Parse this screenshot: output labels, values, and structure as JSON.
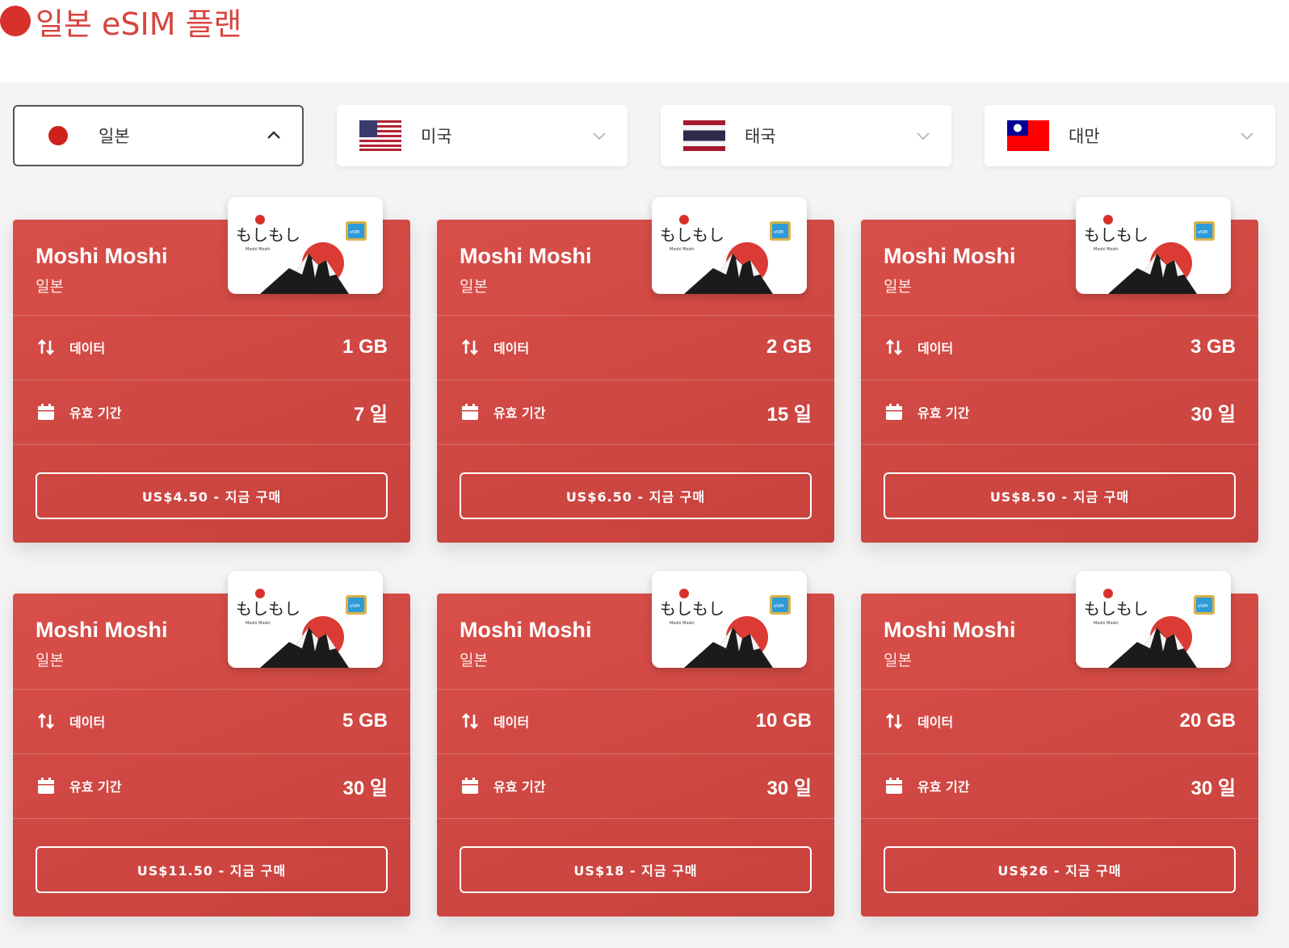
{
  "title": "일본 eSIM 플랜",
  "colors": {
    "accent": "#d8453f",
    "card": "#d04a45"
  },
  "countries": [
    {
      "name": "일본",
      "flag": "japan-flag",
      "active": true
    },
    {
      "name": "미국",
      "flag": "usa-flag",
      "active": false
    },
    {
      "name": "태국",
      "flag": "thailand-flag",
      "active": false
    },
    {
      "name": "대만",
      "flag": "taiwan-flag",
      "active": false
    }
  ],
  "labels": {
    "data": "데이터",
    "validity": "유효 기간"
  },
  "sim_logo": {
    "jp_text": "もしもし",
    "small_text": "Moshi Moshi",
    "chip_text": "eSIM"
  },
  "plans": [
    {
      "brand": "Moshi Moshi",
      "country": "일본",
      "data": "1 GB",
      "days": "7 일",
      "buy": "US$4.50 - 지금 구매"
    },
    {
      "brand": "Moshi Moshi",
      "country": "일본",
      "data": "2 GB",
      "days": "15 일",
      "buy": "US$6.50 - 지금 구매"
    },
    {
      "brand": "Moshi Moshi",
      "country": "일본",
      "data": "3 GB",
      "days": "30 일",
      "buy": "US$8.50 - 지금 구매"
    },
    {
      "brand": "Moshi Moshi",
      "country": "일본",
      "data": "5 GB",
      "days": "30 일",
      "buy": "US$11.50 - 지금 구매"
    },
    {
      "brand": "Moshi Moshi",
      "country": "일본",
      "data": "10 GB",
      "days": "30 일",
      "buy": "US$18 - 지금 구매"
    },
    {
      "brand": "Moshi Moshi",
      "country": "일본",
      "data": "20 GB",
      "days": "30 일",
      "buy": "US$26 - 지금 구매"
    }
  ]
}
